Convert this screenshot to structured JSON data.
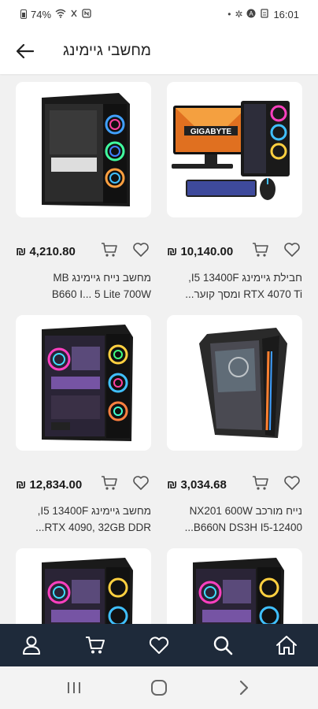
{
  "status_bar": {
    "battery": "74%",
    "time": "16:01"
  },
  "header": {
    "title": "מחשבי גיימינג"
  },
  "products": [
    {
      "price": "10,140.00 ₪",
      "title_line1": "חבילת גיימינג I5 13400F,",
      "title_line2": "RTX 4070 Ti ומסך קוער..."
    },
    {
      "price": "4,210.80 ₪",
      "title_line1": "מחשב נייח גיימינג MB",
      "title_line2": "B660 I... 5 Lite 700W"
    },
    {
      "price": "3,034.68 ₪",
      "title_line1": "נייח מורכב NX201 600W",
      "title_line2": "B660N DS3H I5-12400..."
    },
    {
      "price": "12,834.00 ₪",
      "title_line1": "מחשב גיימינג I5 13400F,",
      "title_line2": "RTX 4090, 32GB DDR..."
    }
  ],
  "colors": {
    "nav_bg": "#1e2a3a",
    "page_bg": "#f1f1f1"
  }
}
